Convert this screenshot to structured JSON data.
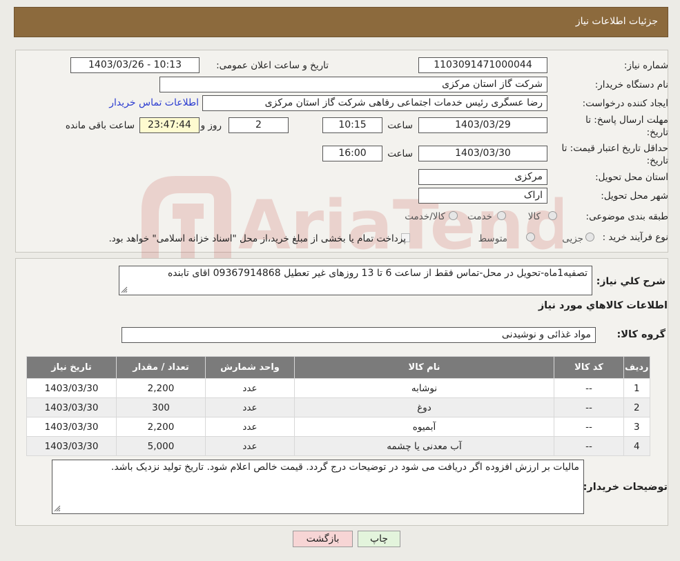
{
  "header": {
    "title": "جزئیات اطلاعات نیاز"
  },
  "form": {
    "need_number_label": "شماره نیاز:",
    "need_number": "1103091471000044",
    "announce_label": "تاریخ و ساعت اعلان عمومی:",
    "announce_value": "1403/03/26 - 10:13",
    "buyer_org_label": "نام دستگاه خریدار:",
    "buyer_org": "شرکت گاز استان مرکزی",
    "creator_label": "ایجاد کننده درخواست:",
    "creator": "رضا عسگری رئیس خدمات اجتماعی رفاهی شرکت گاز استان مرکزی",
    "contact_link": "اطلاعات تماس خریدار",
    "deadline_label_1": "مهلت ارسال پاسخ: تا",
    "deadline_label_2": "تاریخ:",
    "deadline_date": "1403/03/29",
    "time_label": "ساعت",
    "deadline_time": "10:15",
    "days_value": "2",
    "days_label": "روز و",
    "remaining_time": "23:47:44",
    "remaining_label": "ساعت باقی مانده",
    "validity_label_1": "حداقل تاریخ اعتبار قیمت: تا",
    "validity_label_2": "تاریخ:",
    "validity_date": "1403/03/30",
    "validity_time": "16:00",
    "province_label": "استان محل تحویل:",
    "province": "مرکزی",
    "city_label": "شهر محل تحویل:",
    "city": "اراک",
    "category_label": "طبقه بندی موضوعی:",
    "category_options": [
      "کالا",
      "خدمت",
      "کالا/خدمت"
    ],
    "process_label": "نوع فرآیند خرید :",
    "process_options": [
      "جزیی",
      "متوسط"
    ],
    "process_note": "پرداخت تمام یا بخشی از مبلغ خرید،از محل \"اسناد خزانه اسلامی\" خواهد بود."
  },
  "details": {
    "summary_label": "شرح کلي نياز:",
    "summary_text": "تصفیه1ماه-تحویل در محل-تماس فقط از ساعت 6 تا 13 روزهای غیر تعطیل 09367914868 اقای تابنده",
    "goods_info_title": "اطلاعات کالاهاي مورد نياز",
    "goods_group_label": "گروه کالا:",
    "goods_group": "مواد غذائی و نوشیدنی",
    "table": {
      "headers": [
        "ردیف",
        "کد کالا",
        "نام کالا",
        "واحد شمارش",
        "تعداد / مقدار",
        "تاریخ نیاز"
      ],
      "rows": [
        [
          "1",
          "--",
          "نوشابه",
          "عدد",
          "2,200",
          "1403/03/30"
        ],
        [
          "2",
          "--",
          "دوغ",
          "عدد",
          "300",
          "1403/03/30"
        ],
        [
          "3",
          "--",
          "آبمیوه",
          "عدد",
          "2,200",
          "1403/03/30"
        ],
        [
          "4",
          "--",
          "آب معدنی یا چشمه",
          "عدد",
          "5,000",
          "1403/03/30"
        ]
      ]
    },
    "buyer_notes_label": "توضیحات خریدار:",
    "buyer_notes": "مالیات بر ارزش افزوده اگر دریافت می شود در توضیحات درج گردد. قیمت خالص اعلام شود. تاریخ تولید نزدیک باشد."
  },
  "buttons": {
    "print": "چاپ",
    "back": "بازگشت"
  },
  "watermark_text": "AriaTender.neT"
}
